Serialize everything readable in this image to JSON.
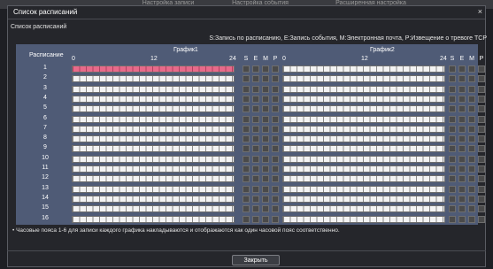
{
  "background_tabs": [
    "Настройка записи",
    "Настройка события",
    "Расширенная настройка"
  ],
  "dialog": {
    "title": "Список расписаний",
    "close_label": "×",
    "section_title": "Список расписаний",
    "legend": "S:Запись по расписанию, E:Запись события, M:Электронная почта, P:Извещение о тревоге TCP",
    "footnote": "• Часовые пояса 1-6 для записи каждого графика накладываются и отображаются как один часовой пояс соответственно.",
    "close_button": "Закрыть"
  },
  "table": {
    "row_header": "Расписание",
    "schedule1": "График1",
    "schedule2": "График2",
    "ticks": [
      "0",
      "12",
      "24"
    ],
    "flags": [
      "S",
      "E",
      "M",
      "P"
    ],
    "rows": [
      "1",
      "2",
      "3",
      "4",
      "5",
      "6",
      "7",
      "8",
      "9",
      "10",
      "11",
      "12",
      "13",
      "14",
      "15",
      "16"
    ],
    "active": {
      "row": "1",
      "schedule": "График1",
      "hours": [
        0,
        24
      ],
      "color": "#e86a8a"
    }
  },
  "colors": {
    "header_bg": "#4f5b76",
    "dialog_bg": "#25262b",
    "cell_bg": "#f3f3f3",
    "flag_box": "#4a4a4a"
  }
}
